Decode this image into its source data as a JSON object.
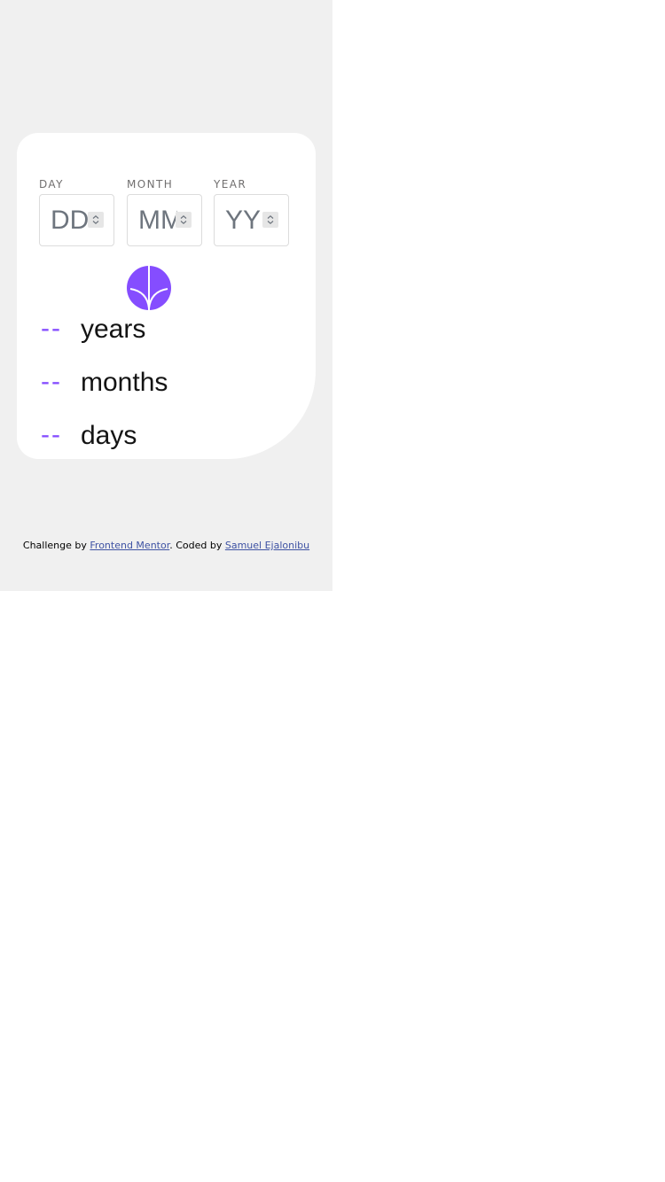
{
  "form": {
    "fields": [
      {
        "label": "DAY",
        "placeholder": "DD",
        "spinner_icon": "up-down-chevron-icon"
      },
      {
        "label": "MONTH",
        "placeholder": "MM",
        "spinner_icon": "up-down-chevron-icon"
      },
      {
        "label": "YEAR",
        "placeholder": "YY",
        "spinner_icon": "up-down-chevron-icon"
      }
    ],
    "submit_icon": "arrow-down-icon",
    "accent_color": "#854dff"
  },
  "results": [
    {
      "value": "--",
      "label": "years"
    },
    {
      "value": "--",
      "label": "months"
    },
    {
      "value": "--",
      "label": "days"
    }
  ],
  "attribution": {
    "prefix": "Challenge by",
    "link1": "Frontend Mentor",
    "middle": ". Coded by",
    "link2": "Samuel Ejalonibu"
  }
}
